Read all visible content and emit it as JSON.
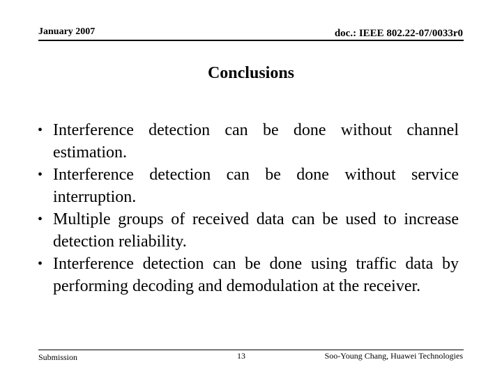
{
  "header": {
    "date": "January 2007",
    "doc_id": "doc.: IEEE 802.22-07/0033r0"
  },
  "slide": {
    "title": "Conclusions",
    "bullets": [
      {
        "text": "Interference detection can be done without channel estimation."
      },
      {
        "text": "Interference detection can be done without service interruption."
      },
      {
        "text": "Multiple groups of received data can be used to increase detection reliability."
      },
      {
        "text": "Interference detection can be done using traffic data by performing decoding and demodulation at the receiver."
      }
    ],
    "bullet_glyph": "•"
  },
  "footer": {
    "left": "Submission",
    "page_number": "13",
    "author": "Soo-Young Chang, Huawei Technologies"
  }
}
